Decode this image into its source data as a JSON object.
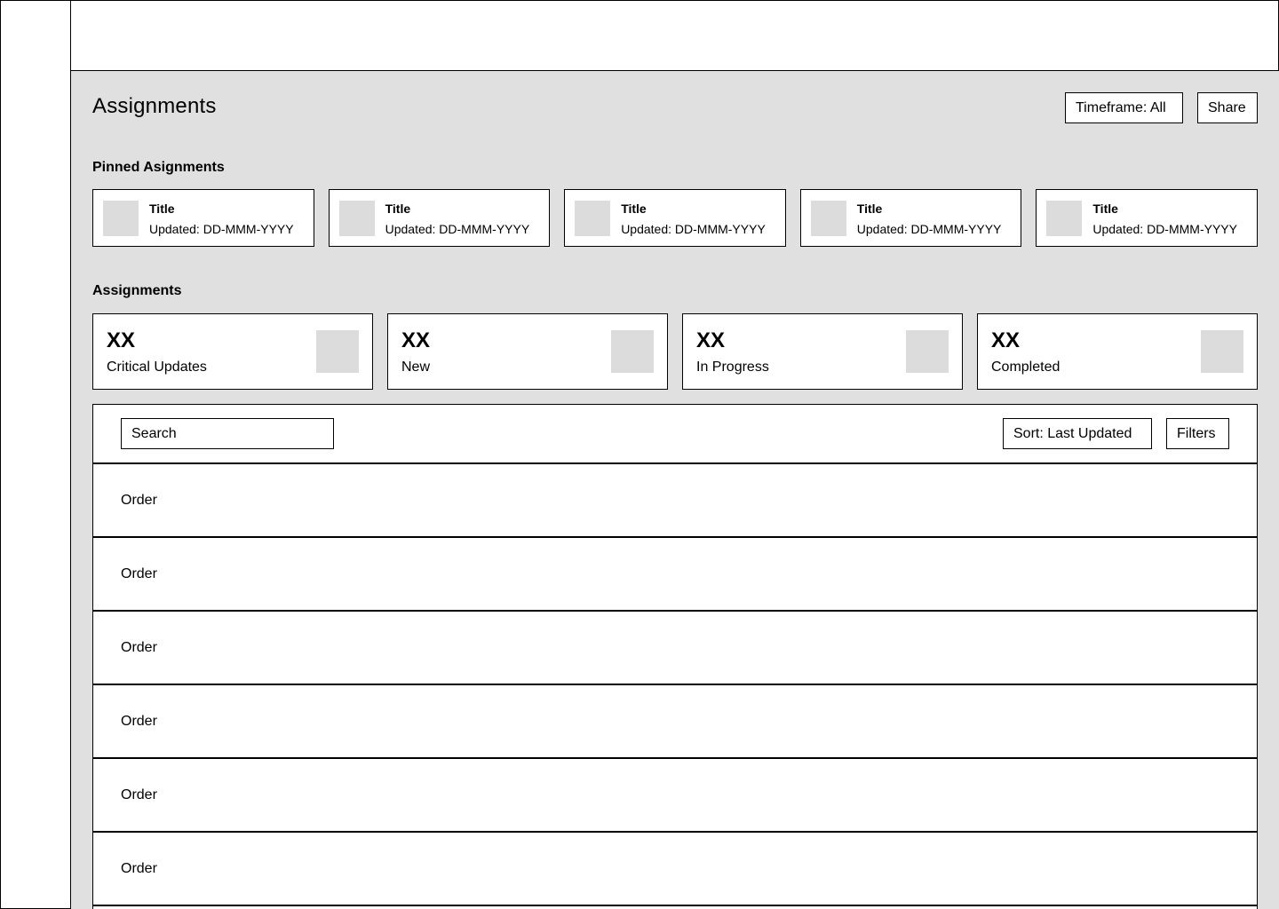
{
  "header": {
    "page_title": "Assignments",
    "timeframe_label": "Timeframe: All",
    "share_label": "Share"
  },
  "pinned": {
    "section_title": "Pinned Asignments",
    "items": [
      {
        "title": "Title",
        "updated": "Updated: DD-MMM-YYYY"
      },
      {
        "title": "Title",
        "updated": "Updated: DD-MMM-YYYY"
      },
      {
        "title": "Title",
        "updated": "Updated: DD-MMM-YYYY"
      },
      {
        "title": "Title",
        "updated": "Updated: DD-MMM-YYYY"
      },
      {
        "title": "Title",
        "updated": "Updated: DD-MMM-YYYY"
      }
    ]
  },
  "assignments": {
    "section_title": "Assignments",
    "stats": [
      {
        "value": "XX",
        "label": "Critical Updates"
      },
      {
        "value": "XX",
        "label": "New"
      },
      {
        "value": "XX",
        "label": "In Progress"
      },
      {
        "value": "XX",
        "label": "Completed"
      }
    ]
  },
  "list": {
    "search_placeholder": "Search",
    "sort_label": "Sort: Last Updated",
    "filters_label": "Filters",
    "rows": [
      {
        "label": "Order"
      },
      {
        "label": "Order"
      },
      {
        "label": "Order"
      },
      {
        "label": "Order"
      },
      {
        "label": "Order"
      },
      {
        "label": "Order"
      }
    ]
  },
  "colors": {
    "main_background": "#e0e0e0",
    "placeholder_thumb": "#dcdcdc",
    "border": "#000000",
    "surface": "#ffffff"
  }
}
